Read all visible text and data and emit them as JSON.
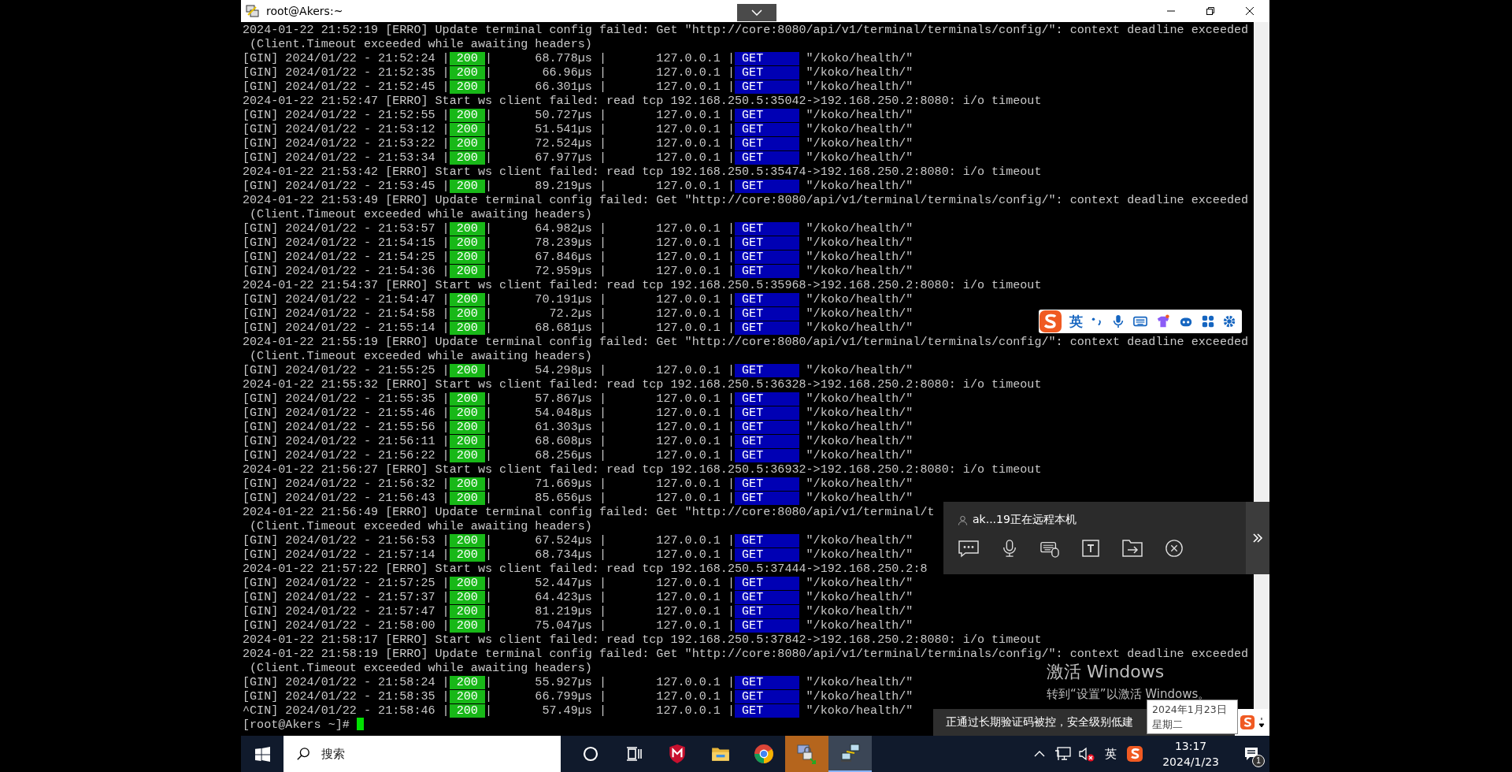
{
  "window": {
    "title": "root@Akers:~"
  },
  "terminal": {
    "lines": [
      {
        "kind": "log",
        "text": "2024-01-22 21:52:19 [ERRO] Update terminal config failed: Get \"http://core:8080/api/v1/terminal/terminals/config/\": context deadline exceeded"
      },
      {
        "kind": "log",
        "text": " (Client.Timeout exceeded while awaiting headers)"
      },
      {
        "kind": "gin",
        "lead": "[GIN] 2024/01/22 - 21:52:24 |",
        "status": "200",
        "middle": "|      68.778µs |       127.0.0.1 |",
        "method": "GET",
        "path": "\"/koko/health/\""
      },
      {
        "kind": "gin",
        "lead": "[GIN] 2024/01/22 - 21:52:35 |",
        "status": "200",
        "middle": "|       66.96µs |       127.0.0.1 |",
        "method": "GET",
        "path": "\"/koko/health/\""
      },
      {
        "kind": "gin",
        "lead": "[GIN] 2024/01/22 - 21:52:45 |",
        "status": "200",
        "middle": "|      66.301µs |       127.0.0.1 |",
        "method": "GET",
        "path": "\"/koko/health/\""
      },
      {
        "kind": "log",
        "text": "2024-01-22 21:52:47 [ERRO] Start ws client failed: read tcp 192.168.250.5:35042->192.168.250.2:8080: i/o timeout"
      },
      {
        "kind": "gin",
        "lead": "[GIN] 2024/01/22 - 21:52:55 |",
        "status": "200",
        "middle": "|      50.727µs |       127.0.0.1 |",
        "method": "GET",
        "path": "\"/koko/health/\""
      },
      {
        "kind": "gin",
        "lead": "[GIN] 2024/01/22 - 21:53:12 |",
        "status": "200",
        "middle": "|      51.541µs |       127.0.0.1 |",
        "method": "GET",
        "path": "\"/koko/health/\""
      },
      {
        "kind": "gin",
        "lead": "[GIN] 2024/01/22 - 21:53:22 |",
        "status": "200",
        "middle": "|      72.524µs |       127.0.0.1 |",
        "method": "GET",
        "path": "\"/koko/health/\""
      },
      {
        "kind": "gin",
        "lead": "[GIN] 2024/01/22 - 21:53:34 |",
        "status": "200",
        "middle": "|      67.977µs |       127.0.0.1 |",
        "method": "GET",
        "path": "\"/koko/health/\""
      },
      {
        "kind": "log",
        "text": "2024-01-22 21:53:42 [ERRO] Start ws client failed: read tcp 192.168.250.5:35474->192.168.250.2:8080: i/o timeout"
      },
      {
        "kind": "gin",
        "lead": "[GIN] 2024/01/22 - 21:53:45 |",
        "status": "200",
        "middle": "|      89.219µs |       127.0.0.1 |",
        "method": "GET",
        "path": "\"/koko/health/\""
      },
      {
        "kind": "log",
        "text": "2024-01-22 21:53:49 [ERRO] Update terminal config failed: Get \"http://core:8080/api/v1/terminal/terminals/config/\": context deadline exceeded"
      },
      {
        "kind": "log",
        "text": " (Client.Timeout exceeded while awaiting headers)"
      },
      {
        "kind": "gin",
        "lead": "[GIN] 2024/01/22 - 21:53:57 |",
        "status": "200",
        "middle": "|      64.982µs |       127.0.0.1 |",
        "method": "GET",
        "path": "\"/koko/health/\""
      },
      {
        "kind": "gin",
        "lead": "[GIN] 2024/01/22 - 21:54:15 |",
        "status": "200",
        "middle": "|      78.239µs |       127.0.0.1 |",
        "method": "GET",
        "path": "\"/koko/health/\""
      },
      {
        "kind": "gin",
        "lead": "[GIN] 2024/01/22 - 21:54:25 |",
        "status": "200",
        "middle": "|      67.846µs |       127.0.0.1 |",
        "method": "GET",
        "path": "\"/koko/health/\""
      },
      {
        "kind": "gin",
        "lead": "[GIN] 2024/01/22 - 21:54:36 |",
        "status": "200",
        "middle": "|      72.959µs |       127.0.0.1 |",
        "method": "GET",
        "path": "\"/koko/health/\""
      },
      {
        "kind": "log",
        "text": "2024-01-22 21:54:37 [ERRO] Start ws client failed: read tcp 192.168.250.5:35968->192.168.250.2:8080: i/o timeout"
      },
      {
        "kind": "gin",
        "lead": "[GIN] 2024/01/22 - 21:54:47 |",
        "status": "200",
        "middle": "|      70.191µs |       127.0.0.1 |",
        "method": "GET",
        "path": "\"/koko/health/\""
      },
      {
        "kind": "gin",
        "lead": "[GIN] 2024/01/22 - 21:54:58 |",
        "status": "200",
        "middle": "|        72.2µs |       127.0.0.1 |",
        "method": "GET",
        "path": "\"/koko/health/\""
      },
      {
        "kind": "gin",
        "lead": "[GIN] 2024/01/22 - 21:55:14 |",
        "status": "200",
        "middle": "|      68.681µs |       127.0.0.1 |",
        "method": "GET",
        "path": "\"/koko/health/\""
      },
      {
        "kind": "log",
        "text": "2024-01-22 21:55:19 [ERRO] Update terminal config failed: Get \"http://core:8080/api/v1/terminal/terminals/config/\": context deadline exceeded"
      },
      {
        "kind": "log",
        "text": " (Client.Timeout exceeded while awaiting headers)"
      },
      {
        "kind": "gin",
        "lead": "[GIN] 2024/01/22 - 21:55:25 |",
        "status": "200",
        "middle": "|      54.298µs |       127.0.0.1 |",
        "method": "GET",
        "path": "\"/koko/health/\""
      },
      {
        "kind": "log",
        "text": "2024-01-22 21:55:32 [ERRO] Start ws client failed: read tcp 192.168.250.5:36328->192.168.250.2:8080: i/o timeout"
      },
      {
        "kind": "gin",
        "lead": "[GIN] 2024/01/22 - 21:55:35 |",
        "status": "200",
        "middle": "|      57.867µs |       127.0.0.1 |",
        "method": "GET",
        "path": "\"/koko/health/\""
      },
      {
        "kind": "gin",
        "lead": "[GIN] 2024/01/22 - 21:55:46 |",
        "status": "200",
        "middle": "|      54.048µs |       127.0.0.1 |",
        "method": "GET",
        "path": "\"/koko/health/\""
      },
      {
        "kind": "gin",
        "lead": "[GIN] 2024/01/22 - 21:55:56 |",
        "status": "200",
        "middle": "|      61.303µs |       127.0.0.1 |",
        "method": "GET",
        "path": "\"/koko/health/\""
      },
      {
        "kind": "gin",
        "lead": "[GIN] 2024/01/22 - 21:56:11 |",
        "status": "200",
        "middle": "|      68.608µs |       127.0.0.1 |",
        "method": "GET",
        "path": "\"/koko/health/\""
      },
      {
        "kind": "gin",
        "lead": "[GIN] 2024/01/22 - 21:56:22 |",
        "status": "200",
        "middle": "|      68.256µs |       127.0.0.1 |",
        "method": "GET",
        "path": "\"/koko/health/\""
      },
      {
        "kind": "log",
        "text": "2024-01-22 21:56:27 [ERRO] Start ws client failed: read tcp 192.168.250.5:36932->192.168.250.2:8080: i/o timeout"
      },
      {
        "kind": "gin",
        "lead": "[GIN] 2024/01/22 - 21:56:32 |",
        "status": "200",
        "middle": "|      71.669µs |       127.0.0.1 |",
        "method": "GET",
        "path": "\"/koko/health/\""
      },
      {
        "kind": "gin",
        "lead": "[GIN] 2024/01/22 - 21:56:43 |",
        "status": "200",
        "middle": "|      85.656µs |       127.0.0.1 |",
        "method": "GET",
        "path": "\"/koko/health/\""
      },
      {
        "kind": "log",
        "text": "2024-01-22 21:56:49 [ERRO] Update terminal config failed: Get \"http://core:8080/api/v1/terminal/t"
      },
      {
        "kind": "log",
        "text": " (Client.Timeout exceeded while awaiting headers)"
      },
      {
        "kind": "gin",
        "lead": "[GIN] 2024/01/22 - 21:56:53 |",
        "status": "200",
        "middle": "|      67.524µs |       127.0.0.1 |",
        "method": "GET",
        "path": "\"/koko/health/\""
      },
      {
        "kind": "gin",
        "lead": "[GIN] 2024/01/22 - 21:57:14 |",
        "status": "200",
        "middle": "|      68.734µs |       127.0.0.1 |",
        "method": "GET",
        "path": "\"/koko/health/\""
      },
      {
        "kind": "log",
        "text": "2024-01-22 21:57:22 [ERRO] Start ws client failed: read tcp 192.168.250.5:37444->192.168.250.2:8"
      },
      {
        "kind": "gin",
        "lead": "[GIN] 2024/01/22 - 21:57:25 |",
        "status": "200",
        "middle": "|      52.447µs |       127.0.0.1 |",
        "method": "GET",
        "path": "\"/koko/health/\""
      },
      {
        "kind": "gin",
        "lead": "[GIN] 2024/01/22 - 21:57:37 |",
        "status": "200",
        "middle": "|      64.423µs |       127.0.0.1 |",
        "method": "GET",
        "path": "\"/koko/health/\""
      },
      {
        "kind": "gin",
        "lead": "[GIN] 2024/01/22 - 21:57:47 |",
        "status": "200",
        "middle": "|      81.219µs |       127.0.0.1 |",
        "method": "GET",
        "path": "\"/koko/health/\""
      },
      {
        "kind": "gin",
        "lead": "[GIN] 2024/01/22 - 21:58:00 |",
        "status": "200",
        "middle": "|      75.047µs |       127.0.0.1 |",
        "method": "GET",
        "path": "\"/koko/health/\""
      },
      {
        "kind": "log",
        "text": "2024-01-22 21:58:17 [ERRO] Start ws client failed: read tcp 192.168.250.5:37842->192.168.250.2:8080: i/o timeout"
      },
      {
        "kind": "log",
        "text": "2024-01-22 21:58:19 [ERRO] Update terminal config failed: Get \"http://core:8080/api/v1/terminal/terminals/config/\": context deadline exceeded"
      },
      {
        "kind": "log",
        "text": " (Client.Timeout exceeded while awaiting headers)"
      },
      {
        "kind": "gin",
        "lead": "[GIN] 2024/01/22 - 21:58:24 |",
        "status": "200",
        "middle": "|      55.927µs |       127.0.0.1 |",
        "method": "GET",
        "path": "\"/koko/health/\""
      },
      {
        "kind": "gin",
        "lead": "[GIN] 2024/01/22 - 21:58:35 |",
        "status": "200",
        "middle": "|      66.799µs |       127.0.0.1 |",
        "method": "GET",
        "path": "\"/koko/health/\""
      },
      {
        "kind": "gin",
        "lead": "^CIN] 2024/01/22 - 21:58:46 |",
        "status": "200",
        "middle": "|       57.49µs |       127.0.0.1 |",
        "method": "GET",
        "path": "\"/koko/health/\""
      },
      {
        "kind": "prompt",
        "text": "[root@Akers ~]#"
      }
    ]
  },
  "ime_toolbar": {
    "mode": "英"
  },
  "remote_panel": {
    "message": "ak...19正在远程本机"
  },
  "activation_notice": {
    "title": "激活 Windows",
    "subtitle": "转到“设置”以激活 Windows。"
  },
  "notification": {
    "text": "正通过长期验证码被控，安全级别低建"
  },
  "date_tooltip": {
    "date": "2024年1月23日",
    "weekday": "星期二"
  },
  "taskbar": {
    "search": {
      "placeholder": "搜索"
    },
    "apps": [
      {
        "kind": "cortana",
        "flashing": false,
        "open": false
      },
      {
        "kind": "task-view",
        "flashing": false,
        "open": false
      },
      {
        "kind": "shield",
        "flashing": false,
        "open": false
      },
      {
        "kind": "folder",
        "flashing": false,
        "open": false
      },
      {
        "kind": "chrome",
        "flashing": false,
        "open": false
      },
      {
        "kind": "lock",
        "flashing": true,
        "open": false
      },
      {
        "kind": "network",
        "flashing": false,
        "open": true
      }
    ],
    "input_mode": "英",
    "time": "13:17",
    "date": "2024/1/23",
    "notification_count": "1"
  }
}
